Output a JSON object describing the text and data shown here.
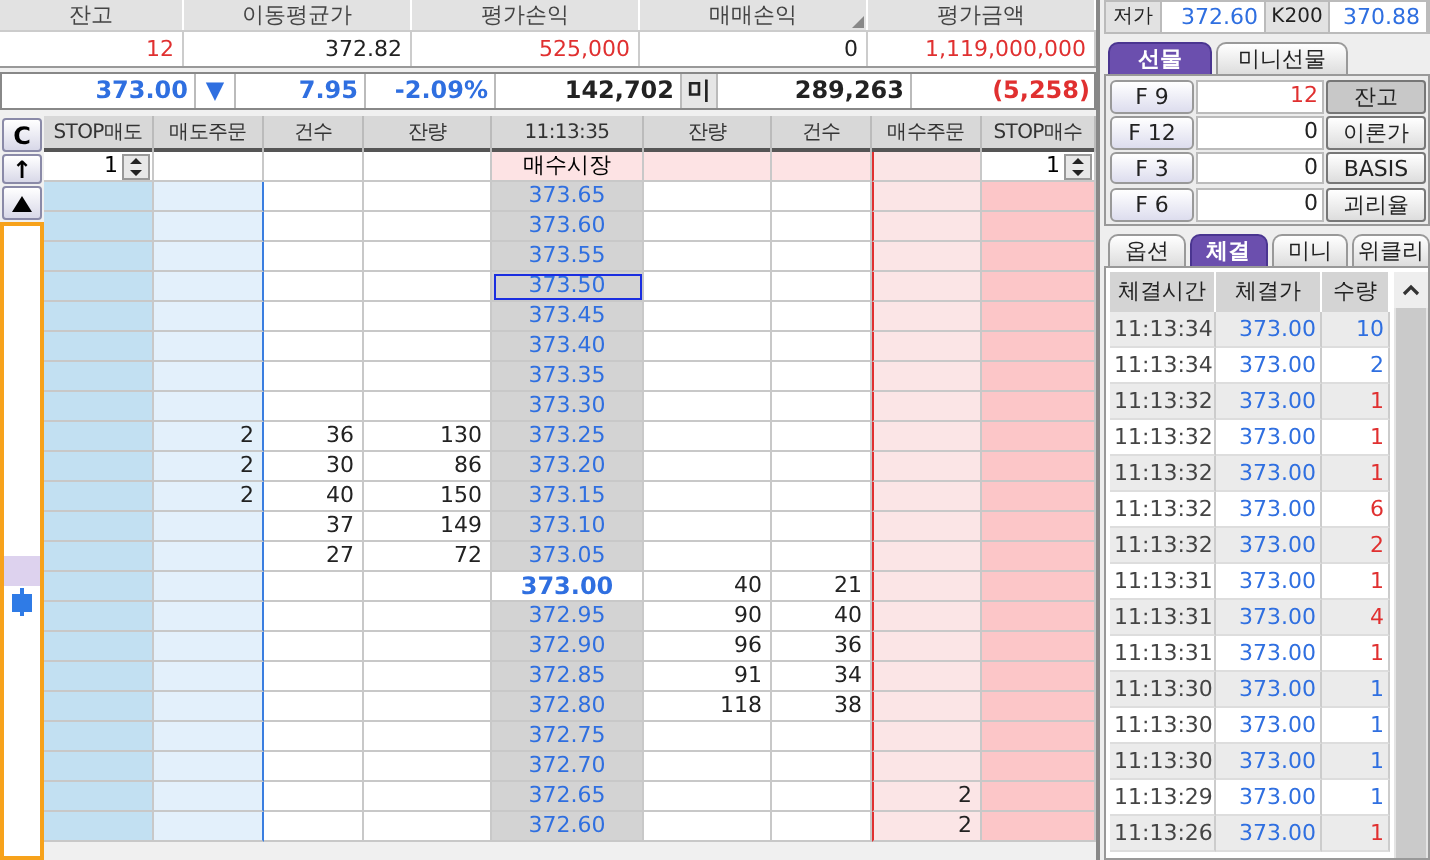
{
  "summary": [
    {
      "label": "잔고",
      "value": "12",
      "color": "#e03030",
      "sortable": false
    },
    {
      "label": "이동평균가",
      "value": "372.82",
      "color": "#222222",
      "sortable": false
    },
    {
      "label": "평가손익",
      "value": "525,000",
      "color": "#e03030",
      "sortable": false
    },
    {
      "label": "매매손익",
      "value": "0",
      "color": "#222222",
      "sortable": true
    },
    {
      "label": "평가금액",
      "value": "1,119,000,000",
      "color": "#e03030",
      "sortable": false
    }
  ],
  "quote": {
    "price": "373.00",
    "direction": "▼",
    "change": "7.95",
    "rate": "-2.09%",
    "volume": "142,702",
    "oi_label": "미",
    "open_interest": "289,263",
    "oi_change": "(5,258)"
  },
  "orderbook": {
    "clear_button": "C",
    "up_button": "↑",
    "columns": [
      "STOP매도",
      "매도주문",
      "건수",
      "잔량",
      "11:13:35",
      "잔량",
      "건수",
      "매수주문",
      "STOP매수"
    ],
    "stop_sell_qty": "1",
    "market_label": "매수시장",
    "stop_buy_qty": "1",
    "rows": [
      {
        "price": "373.65",
        "current": false,
        "selected": false
      },
      {
        "price": "373.60",
        "current": false,
        "selected": false
      },
      {
        "price": "373.55",
        "current": false,
        "selected": false
      },
      {
        "price": "373.50",
        "current": false,
        "selected": true
      },
      {
        "price": "373.45",
        "current": false,
        "selected": false
      },
      {
        "price": "373.40",
        "current": false,
        "selected": false
      },
      {
        "price": "373.35",
        "current": false,
        "selected": false
      },
      {
        "price": "373.30",
        "current": false,
        "selected": false
      },
      {
        "price": "373.25",
        "sell_orders": "2",
        "sell_count": "36",
        "sell_qty": "130",
        "current": false,
        "selected": false
      },
      {
        "price": "373.20",
        "sell_orders": "2",
        "sell_count": "30",
        "sell_qty": "86",
        "current": false,
        "selected": false
      },
      {
        "price": "373.15",
        "sell_orders": "2",
        "sell_count": "40",
        "sell_qty": "150",
        "current": false,
        "selected": false
      },
      {
        "price": "373.10",
        "sell_count": "37",
        "sell_qty": "149",
        "current": false,
        "selected": false
      },
      {
        "price": "373.05",
        "sell_count": "27",
        "sell_qty": "72",
        "current": false,
        "selected": false
      },
      {
        "price": "373.00",
        "buy_qty": "40",
        "buy_count": "21",
        "current": true,
        "selected": false
      },
      {
        "price": "372.95",
        "buy_qty": "90",
        "buy_count": "40",
        "current": false,
        "selected": false
      },
      {
        "price": "372.90",
        "buy_qty": "96",
        "buy_count": "36",
        "current": false,
        "selected": false
      },
      {
        "price": "372.85",
        "buy_qty": "91",
        "buy_count": "34",
        "current": false,
        "selected": false
      },
      {
        "price": "372.80",
        "buy_qty": "118",
        "buy_count": "38",
        "current": false,
        "selected": false
      },
      {
        "price": "372.75",
        "current": false,
        "selected": false
      },
      {
        "price": "372.70",
        "current": false,
        "selected": false
      },
      {
        "price": "372.65",
        "buy_orders": "2",
        "current": false,
        "selected": false
      },
      {
        "price": "372.60",
        "buy_orders": "2",
        "current": false,
        "selected": false
      }
    ]
  },
  "info": [
    {
      "label": "저가",
      "value": "372.60"
    },
    {
      "label": "K200",
      "value": "370.88"
    }
  ],
  "product_tabs": [
    {
      "label": "선물",
      "selected": true
    },
    {
      "label": "미니선물",
      "selected": false
    }
  ],
  "contracts": [
    {
      "code": "F 9",
      "value": "12",
      "color": "#e03030",
      "action": "잔고",
      "selected": true
    },
    {
      "code": "F 12",
      "value": "0",
      "color": "#222222",
      "action": "이론가",
      "selected": false
    },
    {
      "code": "F 3",
      "value": "0",
      "color": "#222222",
      "action": "BASIS",
      "selected": false
    },
    {
      "code": "F 6",
      "value": "0",
      "color": "#222222",
      "action": "괴리율",
      "selected": false
    }
  ],
  "trade_tabs": [
    {
      "label": "옵션",
      "selected": false
    },
    {
      "label": "체결",
      "selected": true
    },
    {
      "label": "미니",
      "selected": false
    },
    {
      "label": "위클리",
      "selected": false
    }
  ],
  "trades": {
    "columns": [
      "체결시간",
      "체결가",
      "수량"
    ],
    "rows": [
      {
        "time": "11:13:34",
        "price": "373.00",
        "qty": "10",
        "color": "#2f6fe0"
      },
      {
        "time": "11:13:34",
        "price": "373.00",
        "qty": "2",
        "color": "#2f6fe0"
      },
      {
        "time": "11:13:32",
        "price": "373.00",
        "qty": "1",
        "color": "#e03030"
      },
      {
        "time": "11:13:32",
        "price": "373.00",
        "qty": "1",
        "color": "#e03030"
      },
      {
        "time": "11:13:32",
        "price": "373.00",
        "qty": "1",
        "color": "#e03030"
      },
      {
        "time": "11:13:32",
        "price": "373.00",
        "qty": "6",
        "color": "#e03030"
      },
      {
        "time": "11:13:32",
        "price": "373.00",
        "qty": "2",
        "color": "#e03030"
      },
      {
        "time": "11:13:31",
        "price": "373.00",
        "qty": "1",
        "color": "#e03030"
      },
      {
        "time": "11:13:31",
        "price": "373.00",
        "qty": "4",
        "color": "#e03030"
      },
      {
        "time": "11:13:31",
        "price": "373.00",
        "qty": "1",
        "color": "#e03030"
      },
      {
        "time": "11:13:30",
        "price": "373.00",
        "qty": "1",
        "color": "#2f6fe0"
      },
      {
        "time": "11:13:30",
        "price": "373.00",
        "qty": "1",
        "color": "#2f6fe0"
      },
      {
        "time": "11:13:30",
        "price": "373.00",
        "qty": "1",
        "color": "#2f6fe0"
      },
      {
        "time": "11:13:29",
        "price": "373.00",
        "qty": "1",
        "color": "#2f6fe0"
      },
      {
        "time": "11:13:26",
        "price": "373.00",
        "qty": "1",
        "color": "#e03030"
      }
    ]
  }
}
